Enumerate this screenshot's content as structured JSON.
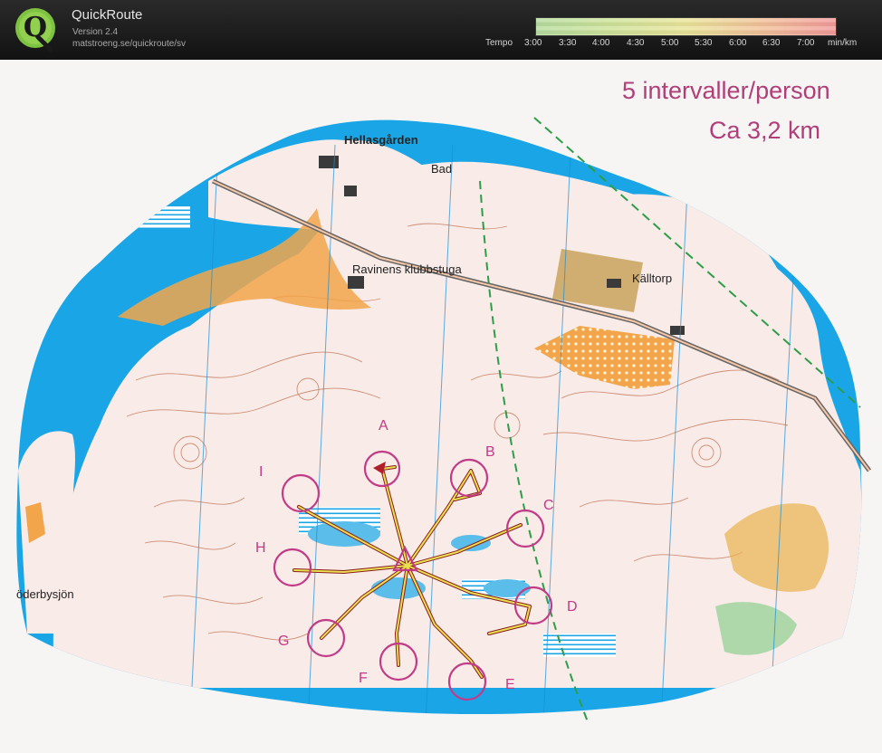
{
  "header": {
    "app_name": "QuickRoute",
    "version": "Version 2.4",
    "url": "matstroeng.se/quickroute/sv"
  },
  "pace_scale": {
    "label": "Tempo",
    "ticks": [
      "3:00",
      "3:30",
      "4:00",
      "4:30",
      "5:00",
      "5:30",
      "6:00",
      "6:30",
      "7:00"
    ],
    "unit": "min/km",
    "colors": [
      "#b6dca0",
      "#cfe39a",
      "#e9e49a",
      "#f1c29a",
      "#f19a9a"
    ]
  },
  "map": {
    "annotations": {
      "line1": "5 intervaller/person",
      "line2": "Ca 3,2 km"
    },
    "place_names": {
      "hellasgarden": "Hellasgården",
      "bad": "Bad",
      "ravinens": "Ravinens klubbstuga",
      "kalltorp": "Källtorp",
      "soderbysjon": "öderbysjön"
    },
    "controls": [
      "A",
      "B",
      "C",
      "D",
      "E",
      "F",
      "G",
      "H",
      "I"
    ],
    "colors": {
      "water": "#1aa6e6",
      "forest": "#f7e9e6",
      "contour": "#b8623a",
      "open_land": "#f2a54a",
      "course": "#c23b86",
      "route": "#e8e050"
    }
  }
}
